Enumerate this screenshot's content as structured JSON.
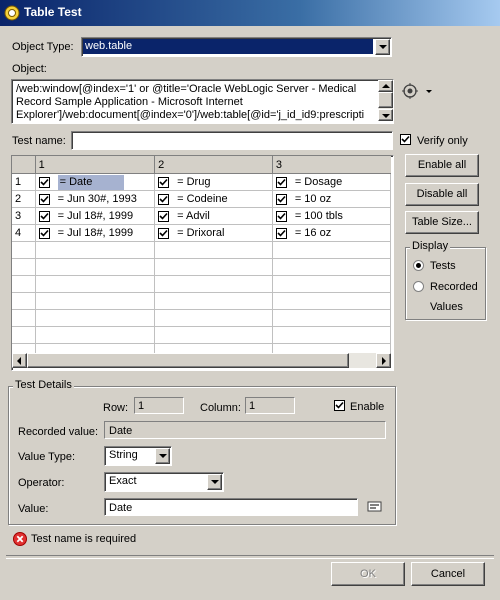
{
  "window": {
    "title": "Table Test",
    "colors": {
      "titlebar": "#0a246a",
      "selection": "#0a246a"
    }
  },
  "object_type": {
    "label": "Object Type:",
    "value": "web.table"
  },
  "object": {
    "label": "Object:",
    "lines": [
      "/web:window[@index='1' or @title='Oracle WebLogic Server - Medical",
      "Record Sample Application - Microsoft Internet",
      "Explorer']/web:document[@index='0']/web:table[@id='j_id_id9:prescripti"
    ]
  },
  "test_name": {
    "label": "Test name:",
    "value": ""
  },
  "verify_only": {
    "label": "Verify only",
    "checked": true
  },
  "grid": {
    "columns": [
      "1",
      "2",
      "3"
    ],
    "rows": [
      {
        "num": "1",
        "cells": [
          "= Date",
          "= Drug",
          "= Dosage"
        ]
      },
      {
        "num": "2",
        "cells": [
          "= Jun 30#, 1993",
          "= Codeine",
          "= 10 oz"
        ]
      },
      {
        "num": "3",
        "cells": [
          "= Jul 18#, 1999",
          "= Advil",
          "= 100 tbls"
        ]
      },
      {
        "num": "4",
        "cells": [
          "= Jul 18#, 1999",
          "= Drixoral",
          "= 16 oz"
        ]
      }
    ]
  },
  "side_buttons": {
    "enable_all": "Enable all",
    "disable_all": "Disable all",
    "table_size": "Table Size..."
  },
  "display": {
    "label": "Display",
    "tests": "Tests",
    "recorded": "Recorded",
    "values": "Values",
    "selected": "Tests"
  },
  "details": {
    "label": "Test Details",
    "row_label": "Row:",
    "row_value": "1",
    "column_label": "Column:",
    "column_value": "1",
    "enable_label": "Enable",
    "enable_checked": true,
    "recorded_label": "Recorded value:",
    "recorded_value": "Date",
    "value_type_label": "Value Type:",
    "value_type": "String",
    "operator_label": "Operator:",
    "operator": "Exact",
    "value_label": "Value:",
    "value": "Date"
  },
  "error": {
    "text": "Test name is required",
    "icon": "error-icon"
  },
  "footer": {
    "ok": "OK",
    "cancel": "Cancel"
  }
}
